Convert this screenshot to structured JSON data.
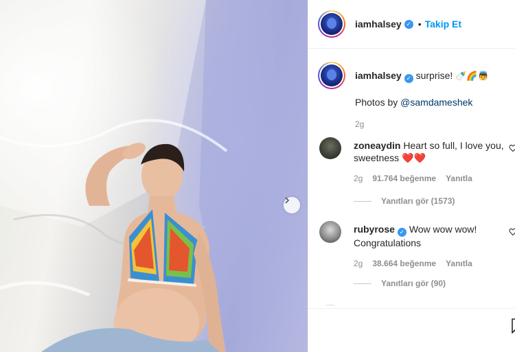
{
  "post": {
    "username": "iamhalsey",
    "follow_label": "Takip Et",
    "separator": "•",
    "caption_text": "surprise!",
    "caption_emoji": "🍼🌈👼",
    "caption_second_line_prefix": "Photos by ",
    "caption_mention": "@samdameshek",
    "caption_time": "2g"
  },
  "comments": [
    {
      "username": "zoneaydin",
      "text": "Heart so full, I love you, sweetness",
      "emoji": "❤️❤️",
      "time": "2g",
      "likes": "91.764 beğenme",
      "reply_label": "Yanıtla",
      "view_replies": "Yanıtları gör (1573)"
    },
    {
      "username": "rubyrose",
      "text": "Wow wow wow!",
      "text2": "Congratulations",
      "time": "2g",
      "likes": "38.664 beğenme",
      "reply_label": "Yanıtla",
      "view_replies": "Yanıtları gör (90)"
    }
  ],
  "icons": {
    "verified": "verified-badge-icon",
    "next": "chevron-right-icon",
    "like": "heart-outline-icon",
    "save": "bookmark-icon"
  },
  "colors": {
    "link_blue": "#0095f6",
    "verified_blue": "#3897f0",
    "muted": "#8e8e8e"
  }
}
